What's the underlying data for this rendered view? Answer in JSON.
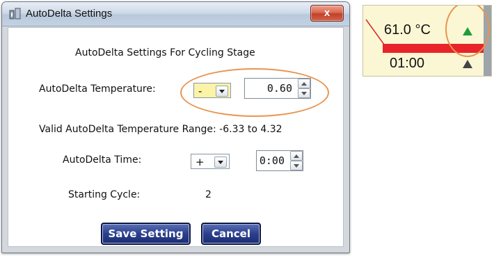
{
  "dialog": {
    "title": "AutoDelta Settings",
    "close_label": "x",
    "heading": "AutoDelta Settings For Cycling Stage",
    "temperature_label": "AutoDelta Temperature:",
    "temperature_sign": "-",
    "temperature_value": "0.60",
    "range_text": "Valid AutoDelta Temperature Range: -6.33 to 4.32",
    "time_label": "AutoDelta Time:",
    "time_sign": "+",
    "time_value": "0:00",
    "starting_cycle_label": "Starting Cycle:",
    "starting_cycle_value": "2",
    "save_label": "Save Setting",
    "cancel_label": "Cancel"
  },
  "inset": {
    "temperature": "61.0 °C",
    "time": "01:00",
    "up_arrow_color": "#1f9d3a",
    "arrow_color": "#444444",
    "bar_color": "#e8242a",
    "background": "#fbf7d4"
  },
  "colors": {
    "highlight_oval": "#e8944f",
    "button_blue": "#1b2d73",
    "sign_dropdown_bg": "#fbf3a8"
  }
}
